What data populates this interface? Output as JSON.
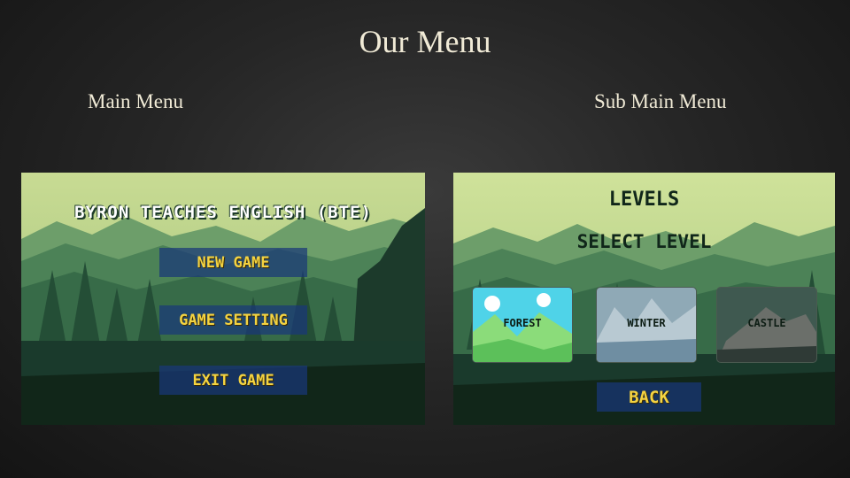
{
  "slide": {
    "title": "Our Menu",
    "left_caption": "Main Menu",
    "right_caption": "Sub Main Menu"
  },
  "main_menu": {
    "game_title": "BYRON TEACHES ENGLISH (BTE)",
    "buttons": [
      "NEW GAME",
      "GAME SETTING",
      "EXIT GAME"
    ]
  },
  "sub_menu": {
    "heading": "LEVELS",
    "subheading": "SELECT LEVEL",
    "levels": [
      "FOREST",
      "WINTER",
      "CASTLE"
    ],
    "back_label": "BACK"
  },
  "colors": {
    "button_bg": "#19377a",
    "button_text": "#f4d341",
    "sky": "#c9dc8f"
  }
}
